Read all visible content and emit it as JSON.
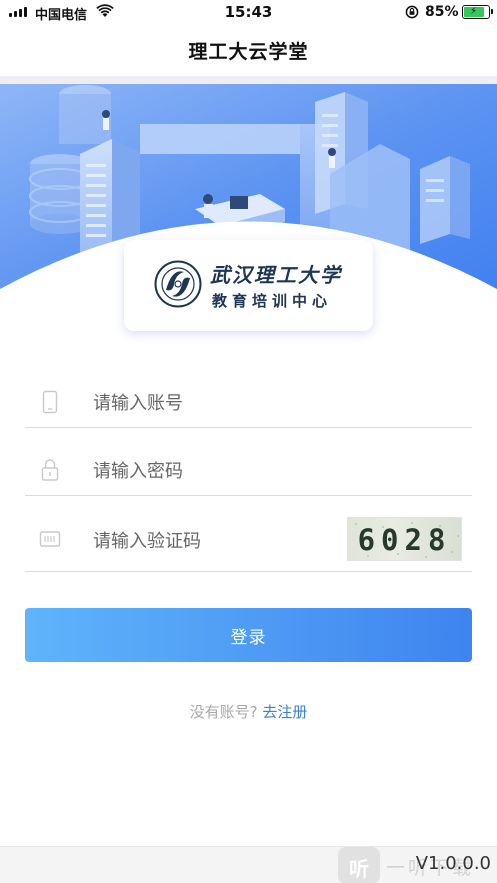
{
  "status_bar": {
    "carrier": "中国电信",
    "time": "15:43",
    "battery_percent": "85%",
    "battery_level": 0.85,
    "icons": [
      "signal-icon",
      "wifi-icon",
      "orientation-lock-icon",
      "battery-charging-icon"
    ]
  },
  "nav": {
    "title": "理工大云学堂"
  },
  "logo": {
    "line1": "武汉理工大学",
    "line2": "教育培训中心"
  },
  "form": {
    "account_placeholder": "请输入账号",
    "password_placeholder": "请输入密码",
    "captcha_placeholder": "请输入验证码",
    "captcha_text": "6028",
    "icons": [
      "phone-icon",
      "lock-icon",
      "keyboard-icon"
    ]
  },
  "login_button": {
    "label": "登录"
  },
  "register": {
    "prompt": "没有账号?",
    "link": "去注册"
  },
  "footer": {
    "version": "V1.0.0.0",
    "watermark_glyph": "听",
    "watermark_text": "一听下载"
  },
  "colors": {
    "accent_blue": "#3f84ef",
    "accent_light_blue": "#5fb4fb",
    "link_blue": "#3b7fd8",
    "banner_blue": "#4f8ff5"
  }
}
